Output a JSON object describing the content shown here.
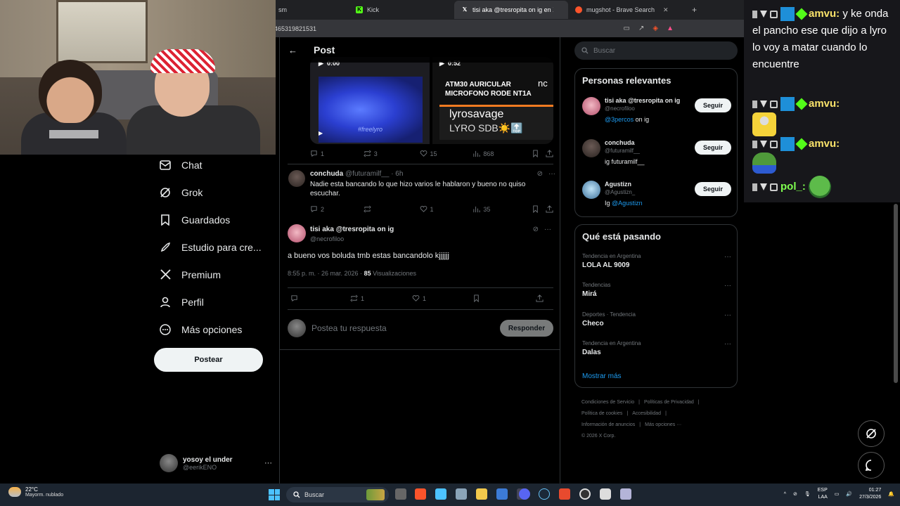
{
  "browser": {
    "tabs": [
      {
        "label": "sm",
        "favicon": "twitch-icon"
      },
      {
        "label": "Kick",
        "favicon": "kick-icon"
      },
      {
        "label": "tisi aka @tresropita on ig en X: \"",
        "favicon": "x-icon",
        "active": true
      },
      {
        "label": "mugshot - Brave Search",
        "favicon": "brave-icon"
      }
    ],
    "url": "465319821531"
  },
  "sidebar": {
    "items": [
      {
        "label": "Chat",
        "icon": "mail-icon"
      },
      {
        "label": "Grok",
        "icon": "grok-icon"
      },
      {
        "label": "Guardados",
        "icon": "bookmark-icon"
      },
      {
        "label": "Estudio para cre...",
        "icon": "rocket-icon"
      },
      {
        "label": "Premium",
        "icon": "x-logo-icon"
      },
      {
        "label": "Perfil",
        "icon": "person-icon"
      },
      {
        "label": "Más opciones",
        "icon": "more-circle-icon"
      }
    ],
    "post_button": "Postear",
    "account": {
      "name": "yosoy el under",
      "handle": "@eerikENO",
      "more": "···"
    }
  },
  "post": {
    "header_title": "Post",
    "media": {
      "video1_time": "0:00",
      "video1_caption": "#freelyro",
      "video2_time": "0:52",
      "video2_line1": "ATM30 AURICULAR",
      "video2_line2": "MICROFONO RODE NT1A",
      "video2_name": "lyrosavage",
      "video2_sub": "LYRO SDB☀️🔝",
      "video2_partial": "nc"
    },
    "quoted_actions": {
      "replies": "1",
      "reposts": "3",
      "likes": "15",
      "views": "868"
    },
    "reply": {
      "name": "conchuda",
      "handle": "@futuramilf__",
      "time": "· 6h",
      "text": "Nadie esta bancando lo que hizo varios le hablaron y bueno no quiso escuchar.",
      "actions": {
        "replies": "2",
        "reposts": "",
        "likes": "1",
        "views": "35"
      }
    },
    "main": {
      "name": "tisi aka @tresropita on ig",
      "handle": "@necrofiloo",
      "text": "a bueno vos boluda tmb estas bancandolo kjjjjjj",
      "time": "8:55 p. m. · 26 mar. 2026 ·",
      "views_count": "85",
      "views_label": "Visualizaciones",
      "actions": {
        "reposts": "1",
        "likes": "1"
      }
    },
    "reply_box": {
      "placeholder": "Postea tu respuesta",
      "button": "Responder"
    }
  },
  "right": {
    "search_placeholder": "Buscar",
    "relevant_title": "Personas relevantes",
    "people": [
      {
        "name": "tisi aka @tresropita on ig",
        "handle": "@necrofiloo",
        "bio_mention": "@3percos",
        "bio_rest": " on ig",
        "button": "Seguir"
      },
      {
        "name": "conchuda",
        "handle": "@futuramilf__",
        "bio_mention": "",
        "bio_rest": "ig futuramilf__",
        "button": "Seguir"
      },
      {
        "name": "Agustizn",
        "handle": "@Agustizn_",
        "bio_mention": "@Agustizn",
        "bio_rest": "Ig ",
        "button": "Seguir"
      }
    ],
    "trends_title": "Qué está pasando",
    "trends": [
      {
        "context": "Tendencia en Argentina",
        "name": "LOLA AL 9009"
      },
      {
        "context": "Tendencias",
        "name": "Mirá"
      },
      {
        "context": "Deportes · Tendencia",
        "name": "Checo"
      },
      {
        "context": "Tendencia en Argentina",
        "name": "Dalas"
      }
    ],
    "show_more": "Mostrar más",
    "footer": [
      "Condiciones de Servicio",
      "|",
      "Políticas de Privacidad",
      "|",
      "Política de cookies",
      "|",
      "Accesibilidad",
      "|",
      "Información de anuncios",
      "|",
      "Más opciones ···",
      "© 2026 X Corp."
    ]
  },
  "chat": {
    "messages": [
      {
        "user": "amvu:",
        "text": " y ke onda el pancho ese que dijo a lyro lo voy a matar cuando lo encuentre"
      },
      {
        "user": "amvu:",
        "text": ""
      },
      {
        "user": "amvu:",
        "text": ""
      },
      {
        "user": "pol_:",
        "text": ""
      }
    ]
  },
  "taskbar": {
    "temp": "22°C",
    "weather": "Mayorm. nublado",
    "search": "Buscar",
    "lang1": "ESP",
    "lang2": "LAA",
    "time": "01:27",
    "date": "27/3/2026"
  },
  "colors": {
    "accent": "#1d9bf0",
    "bg": "#000000",
    "border": "#2f3336",
    "muted": "#71767b"
  }
}
